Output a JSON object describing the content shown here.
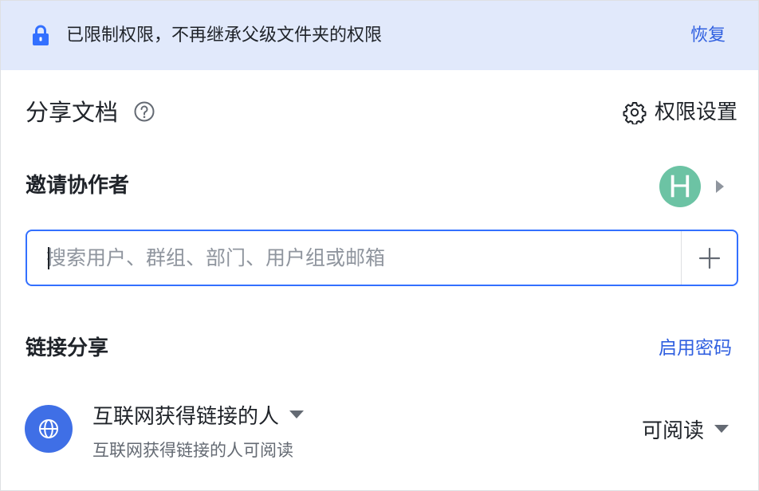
{
  "banner": {
    "text": "已限制权限，不再继承父级文件夹的权限",
    "action": "恢复"
  },
  "header": {
    "title": "分享文档",
    "settings_label": "权限设置"
  },
  "invite": {
    "title": "邀请协作者",
    "avatar_letter": "H",
    "search_placeholder": "搜索用户、群组、部门、用户组或邮箱"
  },
  "link_share": {
    "title": "链接分享",
    "password_action": "启用密码",
    "scope_label": "互联网获得链接的人",
    "scope_description": "互联网获得链接的人可阅读",
    "permission_label": "可阅读"
  },
  "colors": {
    "accent": "#3370ff",
    "link": "#2f5fe0",
    "banner_bg": "#e1e9fb",
    "avatar_bg": "#6cc3a4",
    "globe_bg": "#3f6fe6"
  }
}
